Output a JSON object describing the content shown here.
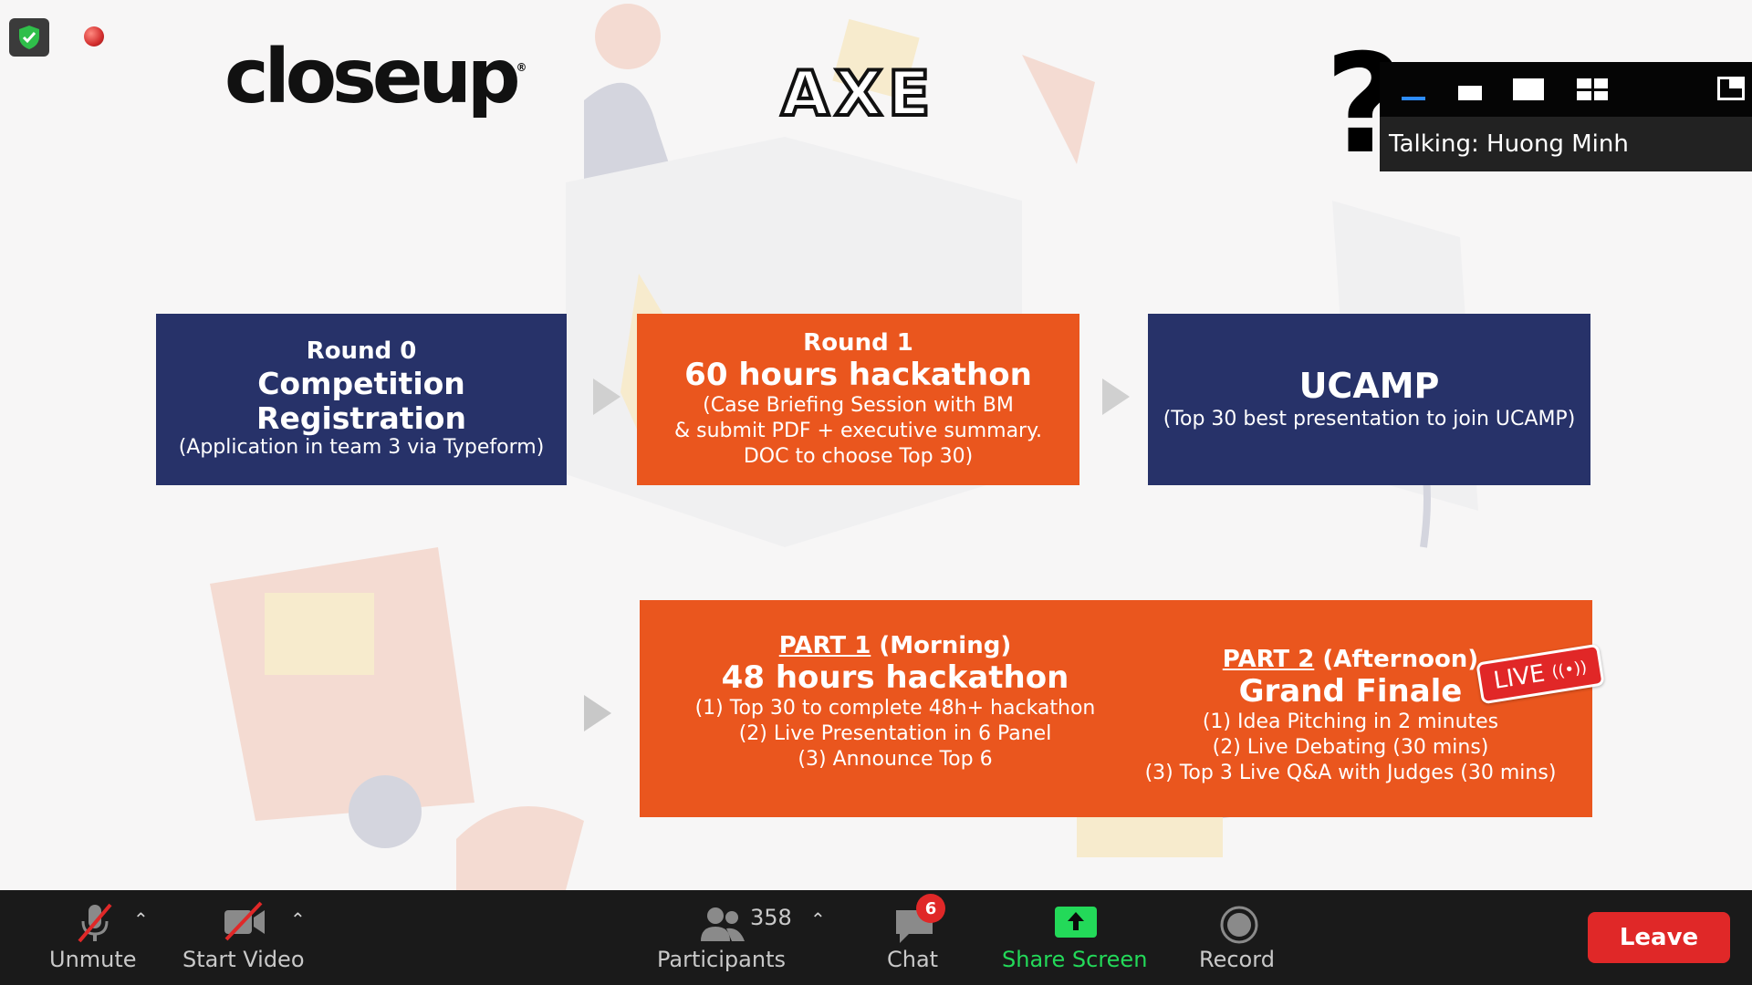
{
  "slide": {
    "logos": {
      "closeup": "closeup",
      "closeup_mark": "®",
      "axe": "AXE"
    },
    "round0": {
      "title": "Round 0",
      "heading": "Competition Registration",
      "desc": "(Application in team 3 via Typeform)"
    },
    "round1": {
      "title": "Round 1",
      "heading": "60 hours hackathon",
      "lines": [
        "(Case Briefing Session with BM",
        "& submit PDF + executive summary.",
        "DOC to choose Top 30)"
      ]
    },
    "ucamp": {
      "heading": "UCAMP",
      "desc": "(Top 30 best presentation to join UCAMP)"
    },
    "part1": {
      "label": "PART 1",
      "when": " (Morning)",
      "heading": "48 hours hackathon",
      "lines": [
        "(1) Top 30 to complete 48h+ hackathon",
        "(2) Live Presentation in 6 Panel",
        "(3) Announce Top 6"
      ]
    },
    "part2": {
      "label": "PART 2",
      "when": " (Afternoon)",
      "heading": "Grand Finale",
      "lines": [
        "(1) Idea Pitching in 2 minutes",
        "(2) Live Debating (30 mins)",
        "(3) Top 3 Live Q&A with Judges (30 mins)"
      ]
    },
    "live_badge": {
      "text": "LIVE",
      "icon": "broadcast-icon"
    }
  },
  "overlay": {
    "question_mark": "?",
    "talking": "Talking: Huong Minh",
    "view_icons": [
      "minimize-icon",
      "strip-view-icon",
      "speaker-view-icon",
      "gallery-view-icon",
      "exit-fullscreen-icon"
    ]
  },
  "toolbar": {
    "unmute": "Unmute",
    "start_video": "Start Video",
    "participants_count": "358",
    "participants": "Participants",
    "chat": "Chat",
    "chat_badge": "6",
    "share_screen": "Share Screen",
    "record": "Record",
    "leave": "Leave"
  },
  "colors": {
    "navy": "#273269",
    "orange": "#ea561e",
    "toolbar_bg": "#1a1a1a",
    "share_green": "#23d959",
    "leave_red": "#e02828"
  }
}
